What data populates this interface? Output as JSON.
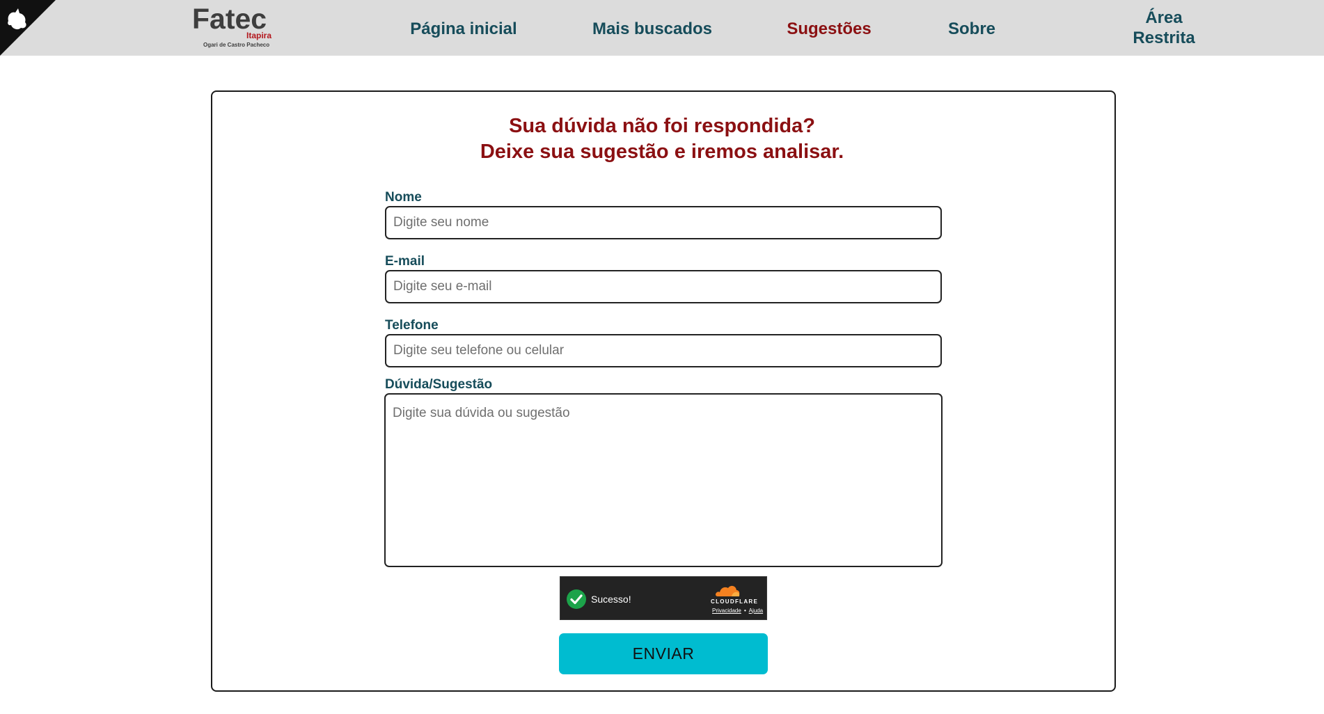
{
  "header": {
    "logo": {
      "name": "Fatec",
      "city": "Itapira",
      "subtitle": "Ogari de Castro Pacheco"
    },
    "corner_icon": "cat-silhouette-icon",
    "nav": {
      "home": "Página inicial",
      "top_searches": "Mais buscados",
      "suggestions": "Sugestões",
      "about": "Sobre",
      "restricted": "Área Restrita"
    },
    "active_item": "Sugestões"
  },
  "form": {
    "title_line1": "Sua dúvida não foi respondida?",
    "title_line2": "Deixe sua sugestão e iremos analisar.",
    "name": {
      "label": "Nome",
      "placeholder": "Digite seu nome",
      "value": ""
    },
    "email": {
      "label": "E-mail",
      "placeholder": "Digite seu e-mail",
      "value": ""
    },
    "phone": {
      "label": "Telefone",
      "placeholder": "Digite seu telefone ou celular",
      "value": ""
    },
    "message": {
      "label": "Dúvida/Sugestão",
      "placeholder": "Digite sua dúvida ou sugestão",
      "value": ""
    },
    "submit_label": "ENVIAR"
  },
  "captcha": {
    "status": "Sucesso!",
    "brand": "CLOUDFLARE",
    "privacy_link": "Privacidade",
    "separator": "•",
    "help_link": "Ajuda",
    "check_icon": "check-circle-icon"
  },
  "colors": {
    "header_bg": "#dcdcdc",
    "nav_text": "#164c5a",
    "accent_red": "#8b1012",
    "button_bg": "#00bcd0",
    "captcha_bg": "#232323",
    "success_green": "#1ca34a",
    "cloudflare_orange": "#f48120"
  }
}
